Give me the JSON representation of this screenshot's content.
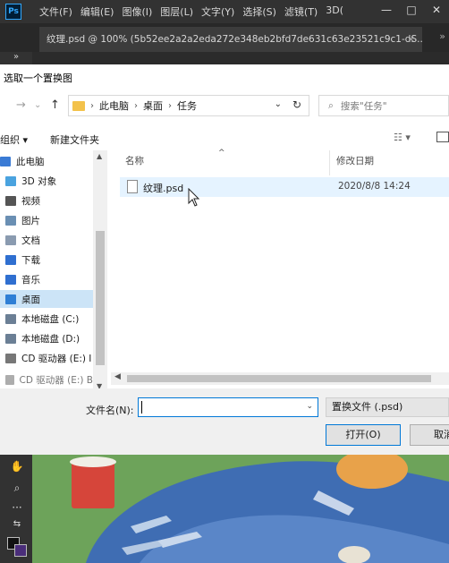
{
  "photoshop": {
    "logo": "Ps",
    "menu": [
      "文件(F)",
      "编辑(E)",
      "图像(I)",
      "图层(L)",
      "文字(Y)",
      "选择(S)",
      "滤镜(T)",
      "3D("
    ],
    "window_controls": [
      "—",
      "□",
      "✕"
    ],
    "tab_title": "纹理.psd @ 100% (5b52ee2a2a2eda272e348eb2bfd7de631c63e23521c9c1-dS...",
    "tab_close": "×",
    "tab_more": "»",
    "tool_expand": "»"
  },
  "dialog": {
    "title": "选取一个置换图",
    "address": {
      "segments": [
        "此电脑",
        "桌面",
        "任务"
      ],
      "separator": "›"
    },
    "search_placeholder": "搜索\"任务\"",
    "commands": {
      "organize": "组织 ▾",
      "new_folder": "新建文件夹"
    },
    "nav_items": [
      {
        "label": "此电脑",
        "color": "#3a7bd5"
      },
      {
        "label": "3D 对象",
        "color": "#4aa3df"
      },
      {
        "label": "视频",
        "color": "#555555"
      },
      {
        "label": "图片",
        "color": "#6a8fb3"
      },
      {
        "label": "文档",
        "color": "#8a9bb0"
      },
      {
        "label": "下载",
        "color": "#2f6fd0"
      },
      {
        "label": "音乐",
        "color": "#2f6fd0"
      },
      {
        "label": "桌面",
        "color": "#2f7fd5"
      },
      {
        "label": "本地磁盘 (C:)",
        "color": "#6b7f95"
      },
      {
        "label": "本地磁盘 (D:)",
        "color": "#6b7f95"
      },
      {
        "label": "CD 驱动器 (E:) I",
        "color": "#777777"
      },
      {
        "label": "CD 驱动器 (E:) B",
        "color": "#777777"
      }
    ],
    "selected_nav": "桌面",
    "columns": {
      "name": "名称",
      "modified": "修改日期"
    },
    "files": [
      {
        "name": "纹理.psd",
        "modified": "2020/8/8 14:24"
      }
    ],
    "filename_label": "文件名(N):",
    "filename_value": "",
    "filter": "置换文件 (.psd)",
    "open_button": "打开(O)",
    "cancel_button": "取消"
  }
}
